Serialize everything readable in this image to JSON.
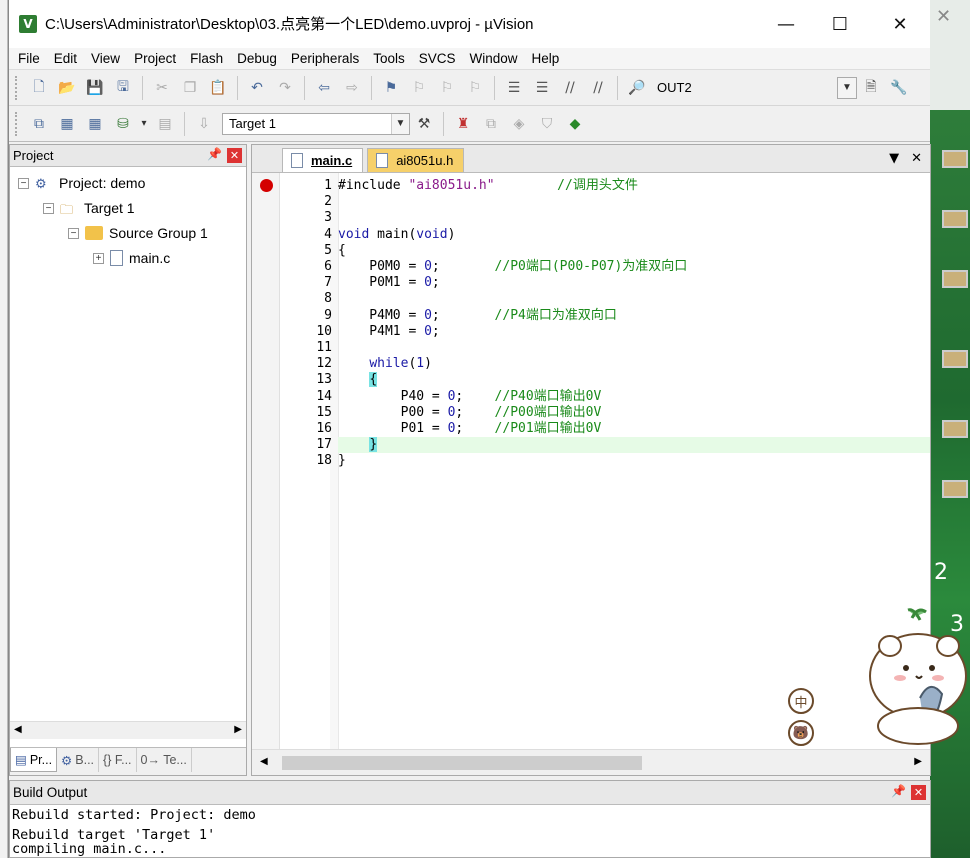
{
  "window": {
    "title": "C:\\Users\\Administrator\\Desktop\\03.点亮第一个LED\\demo.uvproj - µVision",
    "app_icon": "V"
  },
  "menu": [
    "File",
    "Edit",
    "View",
    "Project",
    "Flash",
    "Debug",
    "Peripherals",
    "Tools",
    "SVCS",
    "Window",
    "Help"
  ],
  "toolbar1": {
    "find_combo": "OUT2"
  },
  "toolbar2": {
    "target_combo": "Target 1"
  },
  "project_panel": {
    "title": "Project",
    "tree": {
      "project": "Project: demo",
      "target": "Target 1",
      "group": "Source Group 1",
      "file": "main.c"
    },
    "tabs": [
      "Pr...",
      "B...",
      "{} F...",
      "0→ Te..."
    ]
  },
  "editor": {
    "tabs": [
      "main.c",
      "ai8051u.h"
    ],
    "line_numbers": [
      "1",
      "2",
      "3",
      "4",
      "5",
      "6",
      "7",
      "8",
      "9",
      "10",
      "11",
      "12",
      "13",
      "14",
      "15",
      "16",
      "17",
      "18"
    ],
    "lines": [
      {
        "parts": [
          [
            "pp",
            "#include \"ai8051u.h\"        "
          ],
          [
            "cm",
            "//调用头文件"
          ]
        ]
      },
      {
        "parts": []
      },
      {
        "parts": []
      },
      {
        "parts": [
          [
            "kw",
            "void"
          ],
          [
            "tx",
            " main("
          ],
          [
            "kw",
            "void"
          ],
          [
            "tx",
            ")"
          ]
        ]
      },
      {
        "parts": [
          [
            "tx",
            "{"
          ]
        ]
      },
      {
        "parts": [
          [
            "tx",
            "    P0M0 = "
          ],
          [
            "num",
            "0"
          ],
          [
            "tx",
            ";       "
          ],
          [
            "cm",
            "//P0端口(P00-P07)为准双向口"
          ]
        ]
      },
      {
        "parts": [
          [
            "tx",
            "    P0M1 = "
          ],
          [
            "num",
            "0"
          ],
          [
            "tx",
            ";"
          ]
        ]
      },
      {
        "parts": []
      },
      {
        "parts": [
          [
            "tx",
            "    P4M0 = "
          ],
          [
            "num",
            "0"
          ],
          [
            "tx",
            ";       "
          ],
          [
            "cm",
            "//P4端口为准双向口"
          ]
        ]
      },
      {
        "parts": [
          [
            "tx",
            "    P4M1 = "
          ],
          [
            "num",
            "0"
          ],
          [
            "tx",
            ";"
          ]
        ]
      },
      {
        "parts": []
      },
      {
        "parts": [
          [
            "tx",
            "    "
          ],
          [
            "kw",
            "while"
          ],
          [
            "tx",
            "("
          ],
          [
            "num",
            "1"
          ],
          [
            "tx",
            ")"
          ]
        ]
      },
      {
        "parts": [
          [
            "tx",
            "    "
          ],
          [
            "br",
            "{"
          ]
        ]
      },
      {
        "parts": [
          [
            "tx",
            "        P40 = "
          ],
          [
            "num",
            "0"
          ],
          [
            "tx",
            ";    "
          ],
          [
            "cm",
            "//P40端口输出0V"
          ]
        ]
      },
      {
        "parts": [
          [
            "tx",
            "        P00 = "
          ],
          [
            "num",
            "0"
          ],
          [
            "tx",
            ";    "
          ],
          [
            "cm",
            "//P00端口输出0V"
          ]
        ]
      },
      {
        "parts": [
          [
            "tx",
            "        P01 = "
          ],
          [
            "num",
            "0"
          ],
          [
            "tx",
            ";    "
          ],
          [
            "cm",
            "//P01端口输出0V"
          ]
        ]
      },
      {
        "parts": [
          [
            "tx",
            "    "
          ],
          [
            "br",
            "}"
          ]
        ]
      },
      {
        "parts": [
          [
            "tx",
            "}"
          ]
        ]
      }
    ]
  },
  "build_output": {
    "title": "Build Output",
    "lines": [
      "Rebuild started: Project: demo",
      "Rebuild target 'Target 1'",
      "compiling main.c..."
    ]
  },
  "sticker": {
    "btn1": "中",
    "btn2": "🐻"
  }
}
